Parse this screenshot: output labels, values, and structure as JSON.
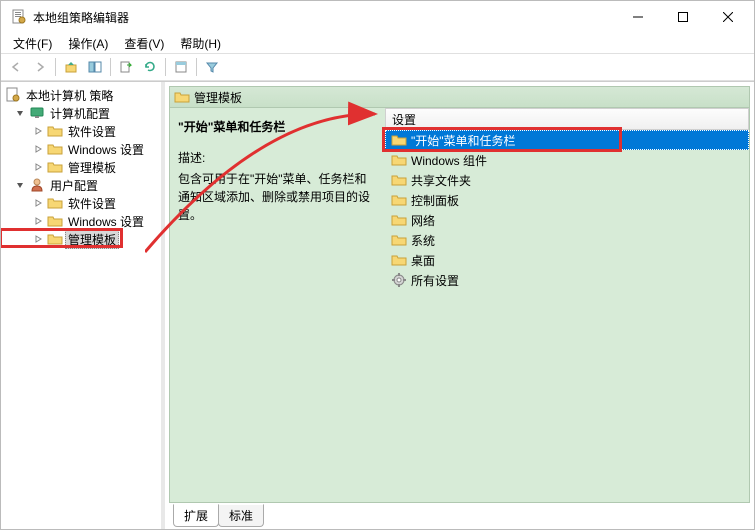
{
  "window": {
    "title": "本地组策略编辑器"
  },
  "menu": {
    "file": "文件(F)",
    "action": "操作(A)",
    "view": "查看(V)",
    "help": "帮助(H)"
  },
  "tree": {
    "root": "本地计算机 策略",
    "computer": "计算机配置",
    "comp_software": "软件设置",
    "comp_windows": "Windows 设置",
    "comp_admin": "管理模板",
    "user": "用户配置",
    "user_software": "软件设置",
    "user_windows": "Windows 设置",
    "user_admin": "管理模板"
  },
  "right": {
    "header": "管理模板",
    "title": "\"开始\"菜单和任务栏",
    "desc_label": "描述:",
    "desc_text": "包含可用于在\"开始\"菜单、任务栏和通知区域添加、删除或禁用项目的设置。",
    "list_header": "设置",
    "items": [
      "\"开始\"菜单和任务栏",
      "Windows 组件",
      "共享文件夹",
      "控制面板",
      "网络",
      "系统",
      "桌面",
      "所有设置"
    ]
  },
  "tabs": {
    "extended": "扩展",
    "standard": "标准"
  }
}
